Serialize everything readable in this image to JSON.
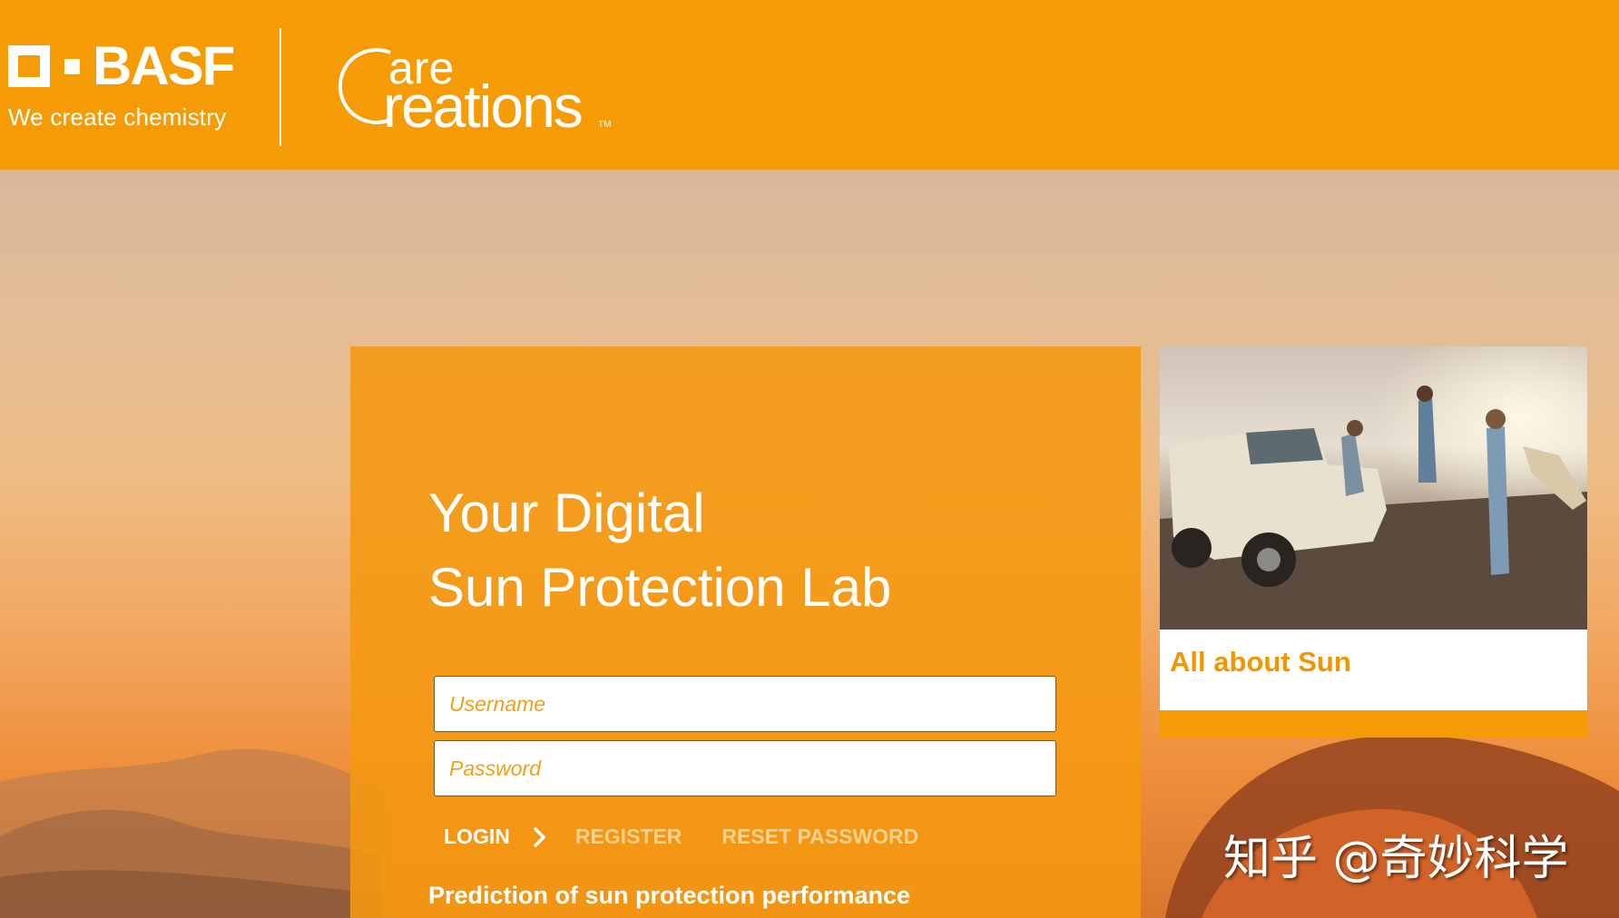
{
  "header": {
    "brand": "BASF",
    "tagline": "We create chemistry",
    "product_logo": {
      "top": "are",
      "bottom": "reations",
      "mark": "TM"
    }
  },
  "login": {
    "headline_line1": "Your Digital",
    "headline_line2": "Sun Protection Lab",
    "username_placeholder": "Username",
    "password_placeholder": "Password",
    "login_label": "LOGIN",
    "register_label": "REGISTER",
    "reset_label": "RESET PASSWORD",
    "subheading": "Prediction of sun protection performance"
  },
  "card": {
    "title": "All about Sun"
  },
  "watermark": "知乎 @奇妙科学",
  "colors": {
    "brand_orange": "#f59b05",
    "card_title": "#f29600"
  }
}
